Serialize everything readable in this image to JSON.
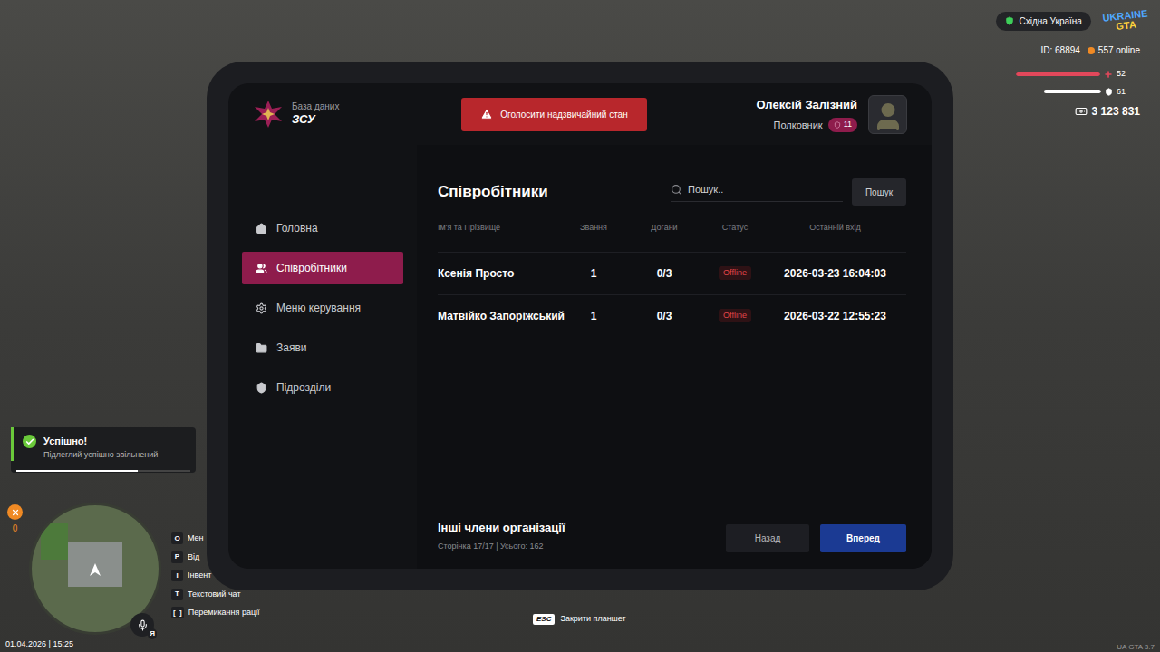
{
  "hud": {
    "region": "Східна Україна",
    "logo": {
      "line1": "UKRAINE",
      "line2": "GTA"
    },
    "player_id": "ID: 68894",
    "online": "557 online",
    "health": {
      "value": "52",
      "level": 1.0
    },
    "armor": {
      "value": "61",
      "level": 0.68
    },
    "money": "3 123 831",
    "version": "UA GTA 3.7"
  },
  "notification": {
    "title": "Успішно!",
    "message": "Підлеглий успішно звільнений",
    "level": 0.7
  },
  "minimap": {
    "badge": "0",
    "mic_key": "Я"
  },
  "key_hints": [
    {
      "key": "O",
      "label": "Мен"
    },
    {
      "key": "P",
      "label": "Від"
    },
    {
      "key": "I",
      "label": "Інвент"
    },
    {
      "key": "T",
      "label": "Текстовий чат"
    },
    {
      "key": "[  ]",
      "label": "Перемикання рації"
    }
  ],
  "datetime": "01.04.2026 | 15:25",
  "esc_hint": {
    "key": "ESC",
    "label": "Закрити планшет"
  },
  "tablet": {
    "db_label": "База даних",
    "org": "ЗСУ",
    "emergency_button": "Оголосити надзвичайний стан",
    "user": {
      "name": "Олексій Залізний",
      "rank": "Полковник",
      "level": "11"
    },
    "sidebar": [
      {
        "label": "Головна",
        "selected": false
      },
      {
        "label": "Співробітники",
        "selected": true
      },
      {
        "label": "Меню керування",
        "selected": false
      },
      {
        "label": "Заяви",
        "selected": false
      },
      {
        "label": "Підрозділи",
        "selected": false
      }
    ],
    "page_title": "Співробітники",
    "search": {
      "placeholder": "Пошук..",
      "button": "Пошук"
    },
    "table": {
      "columns": [
        "Ім'я та Прізвище",
        "Звання",
        "Догани",
        "Статус",
        "Останній вхід"
      ],
      "rows": [
        {
          "name": "Ксенія Просто",
          "rank": "1",
          "reprimands": "0/3",
          "status": "Offline",
          "last_login": "2026-03-23 16:04:03"
        },
        {
          "name": "Матвійко Запоріжський",
          "rank": "1",
          "reprimands": "0/3",
          "status": "Offline",
          "last_login": "2026-03-22 12:55:23"
        }
      ]
    },
    "footer": {
      "title": "Інші члени організації",
      "pagination": "Сторінка 17/17 | Усього: 162",
      "prev": "Назад",
      "next": "Вперед"
    }
  }
}
